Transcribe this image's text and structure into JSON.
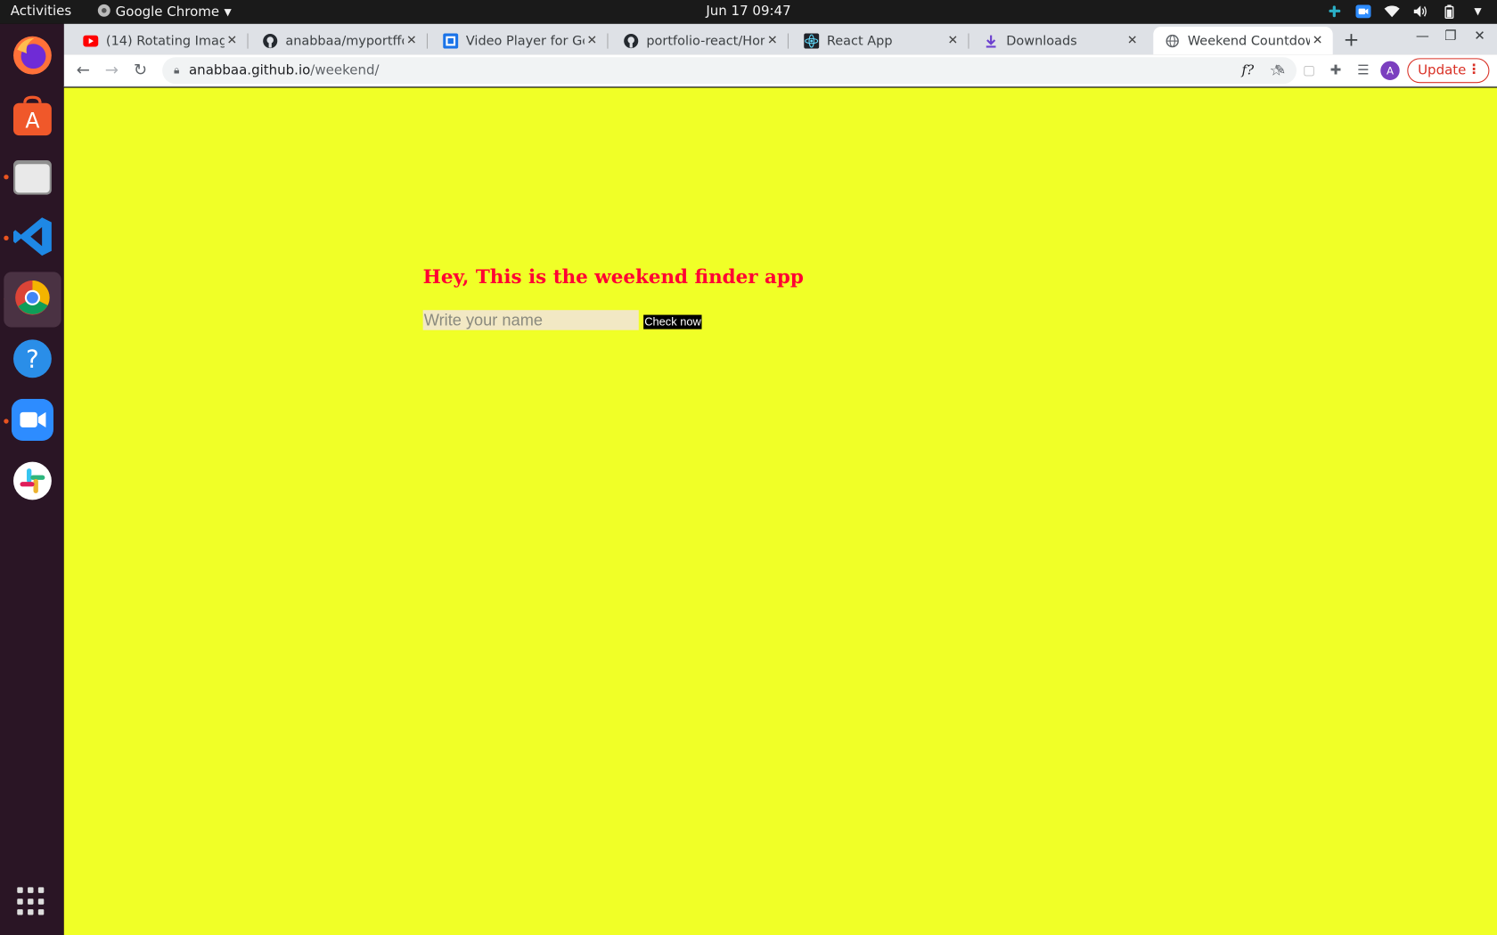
{
  "system": {
    "activities": "Activities",
    "app_menu": "Google Chrome",
    "clock": "Jun 17  09:47"
  },
  "browser": {
    "tabs": [
      {
        "title": "(14) Rotating Image",
        "icon": "youtube-icon"
      },
      {
        "title": "anabbaa/myportffo",
        "icon": "github-icon"
      },
      {
        "title": "Video Player for Goo",
        "icon": "video-player-icon"
      },
      {
        "title": "portfolio-react/Hom",
        "icon": "github-icon"
      },
      {
        "title": "React App",
        "icon": "react-icon"
      },
      {
        "title": "Downloads",
        "icon": "download-icon"
      },
      {
        "title": "Weekend Countdow",
        "icon": "globe-icon"
      }
    ],
    "address": {
      "host": "anabbaa.github.io",
      "path": "/weekend/"
    },
    "profile_initial": "A",
    "update_label": "Update"
  },
  "page": {
    "headline": "Hey, This is the weekend finder app",
    "name_placeholder": "Write your name",
    "check_button": "Check now",
    "background_color": "#f0ff27",
    "headline_color": "#ff0033"
  }
}
